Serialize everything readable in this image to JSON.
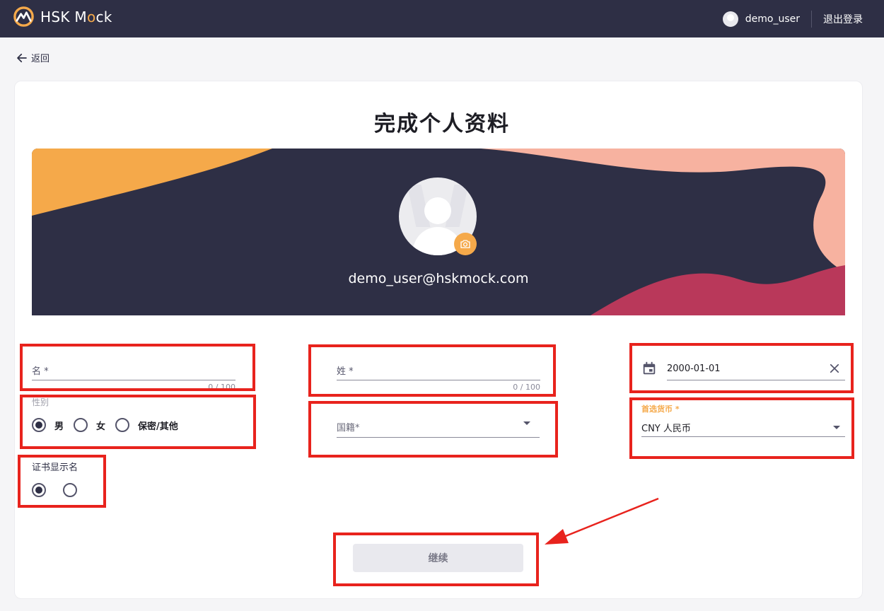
{
  "header": {
    "brand": {
      "prefix": "HSK M",
      "o": "o",
      "suffix": "ck"
    },
    "username": "demo_user",
    "logout_label": "退出登录"
  },
  "back_label": "返回",
  "page_title": "完成个人资料",
  "profile": {
    "email": "demo_user@hskmock.com"
  },
  "form": {
    "first_name": {
      "label": "名 *",
      "counter": "0 / 100"
    },
    "last_name": {
      "label": "姓 *",
      "counter": "0 / 100"
    },
    "birth_date": {
      "value": "2000-01-01"
    },
    "gender": {
      "label": "性别",
      "options": [
        "男",
        "女",
        "保密/其他"
      ],
      "selected": "男"
    },
    "nationality": {
      "placeholder": "国籍*"
    },
    "currency": {
      "label": "首选货币 *",
      "value": "CNY 人民币"
    },
    "cert_name": {
      "label": "证书显示名"
    },
    "continue_label": "继续"
  },
  "colors": {
    "header_bg": "#2e2f45",
    "accent_orange": "#f5a94a",
    "accent_pink": "#f7b2a0",
    "accent_crimson": "#b9385a",
    "annotation_red": "#e8231d"
  }
}
